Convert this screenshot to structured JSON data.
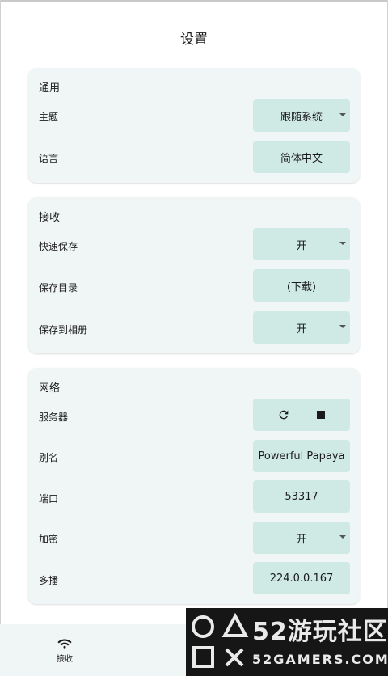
{
  "page": {
    "title": "设置"
  },
  "sections": {
    "general": {
      "title": "通用",
      "theme": {
        "label": "主题",
        "value": "跟随系统"
      },
      "language": {
        "label": "语言",
        "value": "简体中文"
      }
    },
    "receive": {
      "title": "接收",
      "quick_save": {
        "label": "快速保存",
        "value": "开"
      },
      "save_dir": {
        "label": "保存目录",
        "value": "(下载)"
      },
      "save_to_album": {
        "label": "保存到相册",
        "value": "开"
      }
    },
    "network": {
      "title": "网络",
      "server": {
        "label": "服务器",
        "restart_icon": "refresh-icon",
        "stop_icon": "stop-icon"
      },
      "alias": {
        "label": "别名",
        "value": "Powerful Papaya"
      },
      "port": {
        "label": "端口",
        "value": "53317"
      },
      "encryption": {
        "label": "加密",
        "value": "开"
      },
      "multicast": {
        "label": "多播",
        "value": "224.0.0.167"
      }
    }
  },
  "bottom_nav": {
    "items": [
      {
        "label": "接收",
        "icon": "wifi-icon"
      }
    ]
  },
  "watermark": {
    "big": "52游玩社区",
    "small": "52GAMERS.COM"
  },
  "colors": {
    "card_bg": "#f0f6f5",
    "control_bg": "#cfe9e5",
    "text": "#1b1b1b"
  }
}
